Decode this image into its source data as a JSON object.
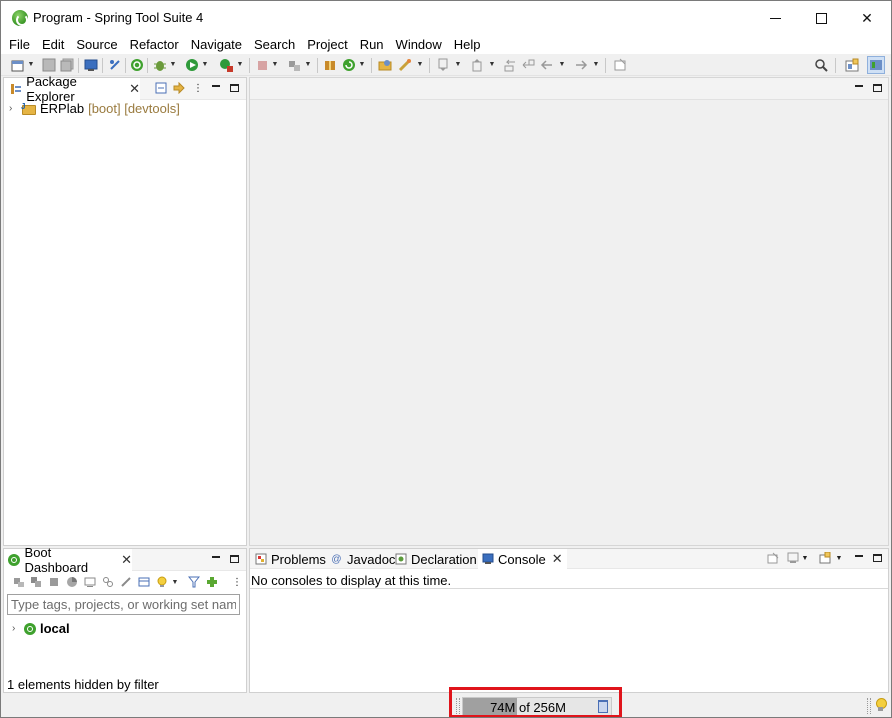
{
  "window": {
    "title": "Program - Spring Tool Suite 4"
  },
  "menu": [
    "File",
    "Edit",
    "Source",
    "Refactor",
    "Navigate",
    "Search",
    "Project",
    "Run",
    "Window",
    "Help"
  ],
  "package_explorer": {
    "tab_label": "Package Explorer",
    "project": {
      "name": "ERPlab",
      "decorations": "[boot] [devtools]"
    }
  },
  "boot_dashboard": {
    "tab_label": "Boot Dashboard",
    "filter_placeholder": "Type tags, projects, or working set names",
    "local_label": "local",
    "hidden_message": "1 elements hidden by filter"
  },
  "bottom_tabs": {
    "problems": "Problems",
    "javadoc": "Javadoc",
    "declaration": "Declaration",
    "console": "Console"
  },
  "console": {
    "message": "No consoles to display at this time."
  },
  "status": {
    "heap_text": "74M of 256M",
    "heap_used_fraction": 0.289
  },
  "colors": {
    "highlight": "#e0141b",
    "spring_green": "#3fa12e"
  }
}
